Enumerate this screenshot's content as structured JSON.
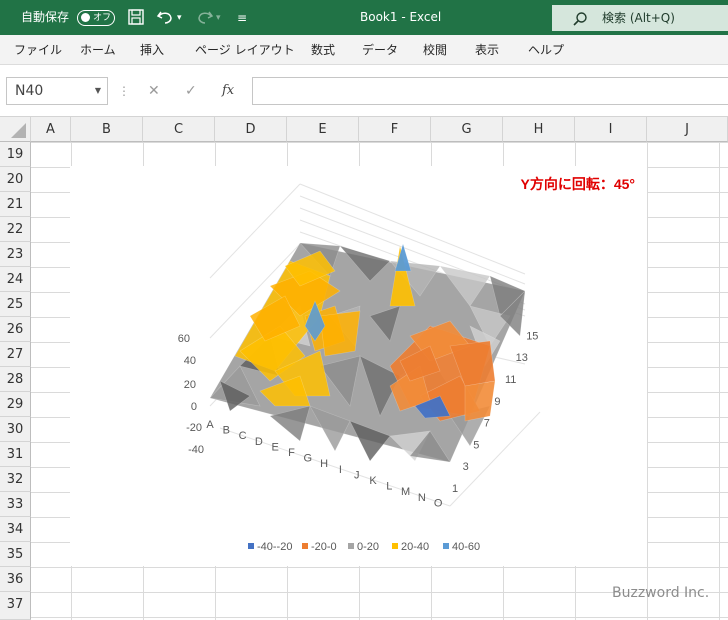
{
  "titlebar": {
    "autosave_label": "自動保存",
    "autosave_state": "オフ",
    "file_title": "Book1  -  Excel",
    "search_placeholder": "検索 (Alt+Q)"
  },
  "ribbon_tabs": [
    "ファイル",
    "ホーム",
    "挿入",
    "ページ レイアウト",
    "数式",
    "データ",
    "校閲",
    "表示",
    "ヘルプ"
  ],
  "formula_bar": {
    "name_box": "N40",
    "fx_label": "fx",
    "formula": ""
  },
  "columns": [
    "A",
    "B",
    "C",
    "D",
    "E",
    "F",
    "G",
    "H",
    "I",
    "J"
  ],
  "rows": [
    "19",
    "20",
    "21",
    "22",
    "23",
    "24",
    "25",
    "26",
    "27",
    "28",
    "29",
    "30",
    "31",
    "32",
    "33",
    "34",
    "35",
    "36",
    "37"
  ],
  "chart_data": {
    "type": "surface",
    "title": "",
    "annotation": "Y方向に回転：45°",
    "annotation_color": "#e00000",
    "z_ticks": [
      "60",
      "40",
      "20",
      "0",
      "-20",
      "-40"
    ],
    "x_ticks": [
      "A",
      "B",
      "C",
      "D",
      "E",
      "F",
      "G",
      "H",
      "I",
      "J",
      "K",
      "L",
      "M",
      "N",
      "O"
    ],
    "y_ticks": [
      "1",
      "3",
      "5",
      "7",
      "9",
      "11",
      "13",
      "15"
    ],
    "legend": [
      {
        "label": "-40--20",
        "color": "#4472c4"
      },
      {
        "label": "-20-0",
        "color": "#ed7d31"
      },
      {
        "label": "0-20",
        "color": "#a5a5a5"
      },
      {
        "label": "20-40",
        "color": "#ffc000"
      },
      {
        "label": "40-60",
        "color": "#5b9bd5"
      }
    ],
    "rotation_y_degrees": 45,
    "legend_position": "bottom"
  },
  "watermark": "Buzzword Inc."
}
